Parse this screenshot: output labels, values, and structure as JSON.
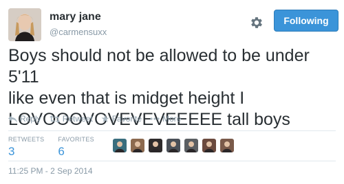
{
  "user": {
    "display_name": "mary jane",
    "handle": "@carmensuxx",
    "avatar_icon": "profile-photo"
  },
  "header": {
    "settings_icon": "gear-icon",
    "follow_label": "Following",
    "follow_color": "#3b94d9"
  },
  "tweet": {
    "text": "Boys should not be allowed to be under 5'11\nlike even that is midget height I\nLOVOOOVOVEVEVEEEEE tall boys"
  },
  "actions": {
    "reply": "Reply",
    "retweet": "Retweet",
    "favorite": "Favorite",
    "more": "More"
  },
  "stats": {
    "retweets_label": "RETWEETS",
    "retweets_count": "3",
    "favorites_label": "FAVORITES",
    "favorites_count": "6"
  },
  "favoriter_avatars": [
    {
      "color": "#3a6e7e"
    },
    {
      "color": "#8c6a4f"
    },
    {
      "color": "#2e2b2c"
    },
    {
      "color": "#4a5058"
    },
    {
      "color": "#5b5f63"
    },
    {
      "color": "#6b4a3e"
    },
    {
      "color": "#7a5a4a"
    }
  ],
  "timestamp": "11:25 PM - 2 Sep 2014"
}
